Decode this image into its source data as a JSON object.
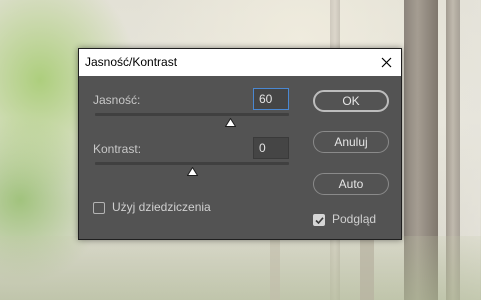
{
  "dialog": {
    "title": "Jasność/Kontrast",
    "brightness": {
      "label": "Jasność:",
      "value": "60",
      "level": 0.7
    },
    "contrast": {
      "label": "Kontrast:",
      "value": "0",
      "level": 0.5
    },
    "buttons": {
      "ok": "OK",
      "cancel": "Anuluj",
      "auto": "Auto"
    },
    "legacy": {
      "label": "Użyj dziedziczenia",
      "checked": false
    },
    "preview": {
      "label": "Podgląd",
      "checked": true
    }
  },
  "icons": {
    "close": "close-icon",
    "slider_thumb": "triangle-thumb-icon",
    "checkmark": "checkmark-icon"
  },
  "colors": {
    "dialog_bg": "#535353",
    "focus_border": "#4a88d2",
    "titlebar_bg": "#ffffff"
  }
}
